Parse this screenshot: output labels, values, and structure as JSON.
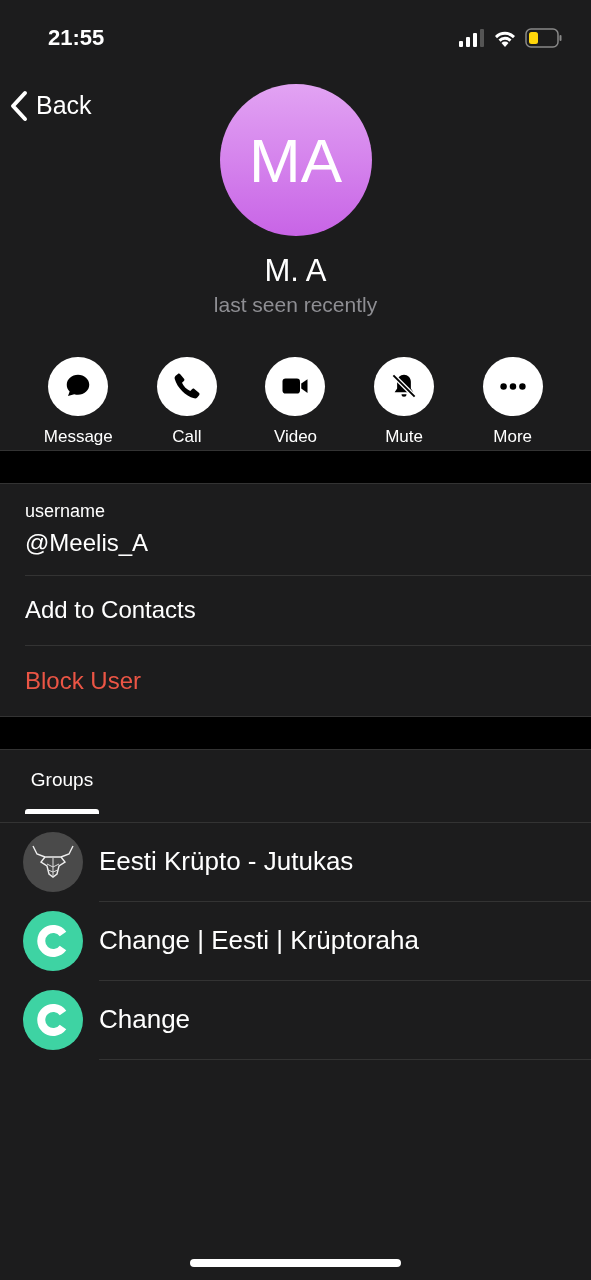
{
  "status_bar": {
    "time": "21:55"
  },
  "nav": {
    "back": "Back"
  },
  "profile": {
    "initials": "MA",
    "name": "M. A",
    "status": "last seen recently"
  },
  "actions": [
    {
      "label": "Message",
      "kind": "message"
    },
    {
      "label": "Call",
      "kind": "call"
    },
    {
      "label": "Video",
      "kind": "video"
    },
    {
      "label": "Mute",
      "kind": "mute"
    },
    {
      "label": "More",
      "kind": "more"
    }
  ],
  "info": [
    {
      "kind": "field",
      "label": "username",
      "value": "@Meelis_A"
    },
    {
      "kind": "action",
      "value": "Add to Contacts"
    },
    {
      "kind": "danger",
      "value": "Block User"
    }
  ],
  "tabs": [
    {
      "label": "Groups",
      "selected": true
    }
  ],
  "groups": [
    {
      "name": "Eesti Krüpto - Jutukas",
      "kind": "bull"
    },
    {
      "name": "Change | Eesti | Krüptoraha",
      "kind": "c-logo"
    },
    {
      "name": "Change",
      "kind": "c-logo"
    }
  ]
}
